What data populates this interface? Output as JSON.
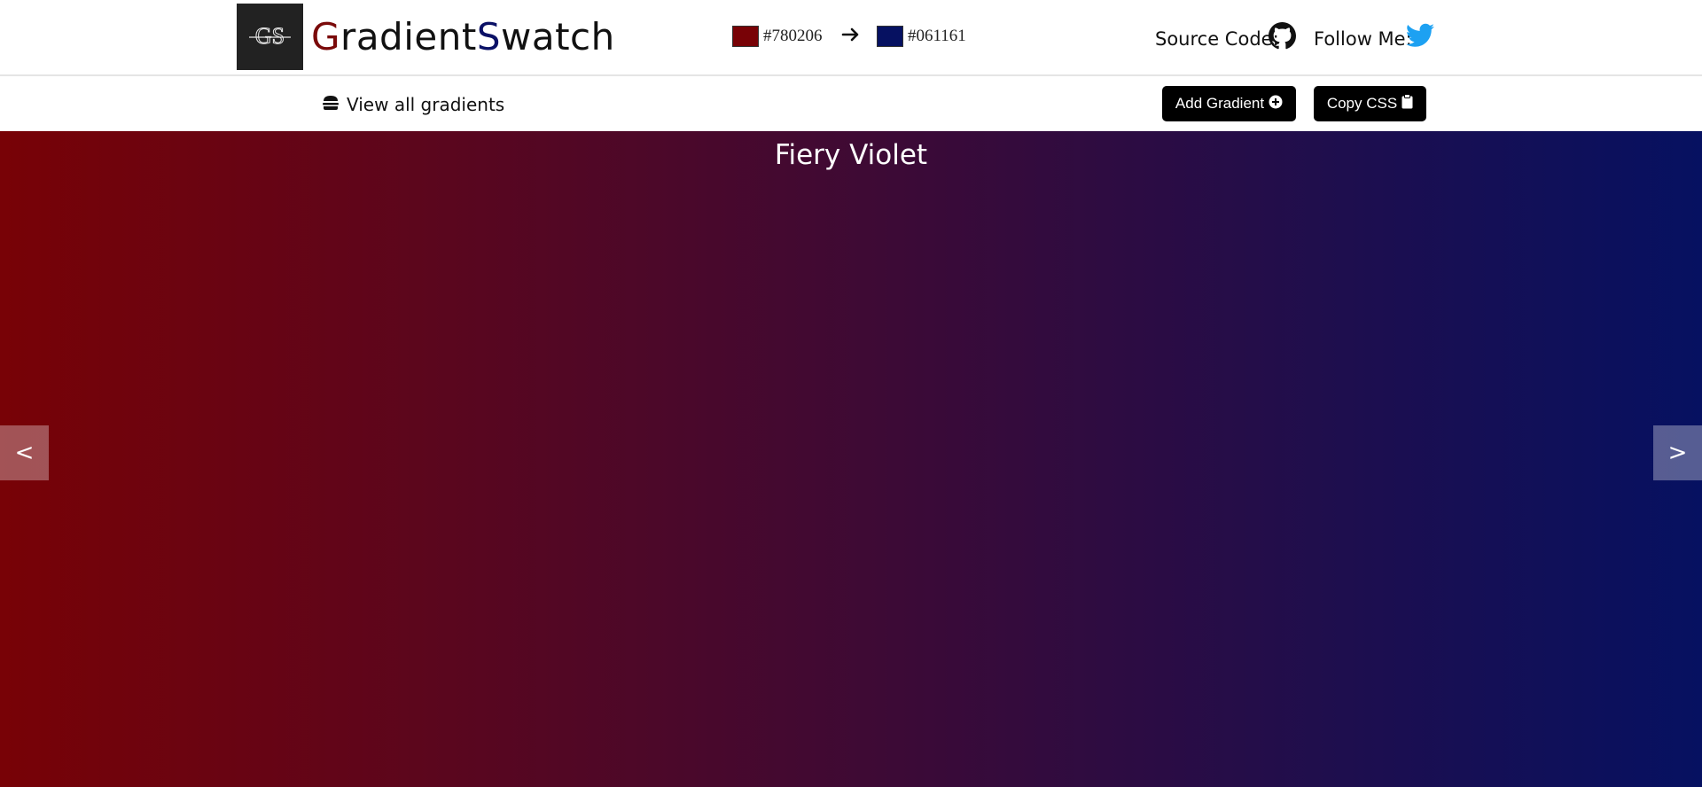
{
  "header": {
    "logo_text": "GS",
    "brand_first_letter": "G",
    "brand_mid": "radient",
    "brand_second_letter": "S",
    "brand_end": "watch",
    "from_color": "#780206",
    "to_color": "#061161",
    "source_code_label": "Source Code:",
    "follow_me_label": "Follow Me:"
  },
  "subbar": {
    "view_all_label": "View all gradients",
    "add_gradient_label": "Add Gradient",
    "copy_css_label": "Copy CSS"
  },
  "gradient": {
    "name": "Fiery Violet",
    "start": "#780206",
    "end": "#061161",
    "prev_label": "<",
    "next_label": ">"
  },
  "icons": {
    "logo": "gs-logo-icon",
    "arrow": "arrow-right-icon",
    "github": "github-icon",
    "twitter": "twitter-icon",
    "menu": "hamburger-icon",
    "plus": "plus-circle-icon",
    "clipboard": "clipboard-icon"
  },
  "colors": {
    "brand_g": "#7a0a0a",
    "brand_s": "#0b1166",
    "twitter_blue": "#1da1f2",
    "button_bg": "#000000"
  }
}
